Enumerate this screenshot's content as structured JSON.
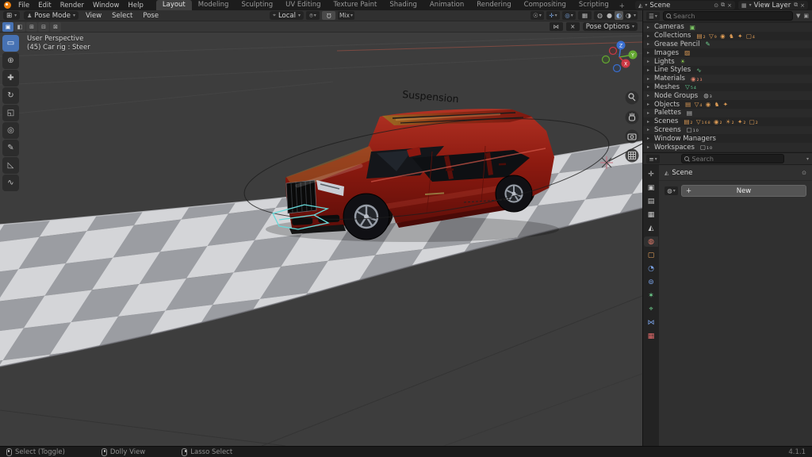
{
  "icons": {
    "chevron_down": "▾",
    "chevron_right": "▸",
    "editor_type_3d": "⊞",
    "editor_type_outliner": "☰",
    "editor_type_props": "≡",
    "pose_figure": "♟",
    "orientation": "⌖",
    "pivot": "⌾",
    "magnet": "Ω",
    "mirror_x": "⋈",
    "snap_x": "×",
    "visibility_eye": "☉",
    "gizmo_toggle": "✛",
    "overlays_toggle": "◎",
    "xray_toggle": "▦",
    "pin": "⊙",
    "copy_datablock": "⧉",
    "close_x": "×",
    "funnel": "▼",
    "collection_box": "▣",
    "scene_crumb": "◭",
    "world_globe": "◍",
    "plus": "+"
  },
  "topbar": {
    "menus": [
      {
        "label": "File"
      },
      {
        "label": "Edit"
      },
      {
        "label": "Render"
      },
      {
        "label": "Window"
      },
      {
        "label": "Help"
      }
    ],
    "tabs": [
      {
        "label": "Layout",
        "active": true
      },
      {
        "label": "Modeling"
      },
      {
        "label": "Sculpting"
      },
      {
        "label": "UV Editing"
      },
      {
        "label": "Texture Paint"
      },
      {
        "label": "Shading"
      },
      {
        "label": "Animation"
      },
      {
        "label": "Rendering"
      },
      {
        "label": "Compositing"
      },
      {
        "label": "Scripting"
      }
    ],
    "add_tab": "+",
    "scene_selector": {
      "label": "Scene"
    },
    "view_layer_selector": {
      "label": "View Layer"
    }
  },
  "viewport_header": {
    "mode_label": "Pose Mode",
    "menus": [
      {
        "label": "View"
      },
      {
        "label": "Select"
      },
      {
        "label": "Pose"
      }
    ],
    "orientation_label": "Local",
    "snap_label": "Mix",
    "pose_options_label": "Pose Options",
    "select_modes": [
      {
        "glyph": "▣",
        "active": true
      },
      {
        "glyph": "◧"
      },
      {
        "glyph": "⊞"
      },
      {
        "glyph": "⊟"
      },
      {
        "glyph": "⊠"
      }
    ],
    "shading_modes": [
      {
        "name": "wireframe",
        "glyph": "◍"
      },
      {
        "name": "solid",
        "glyph": "●"
      },
      {
        "name": "material-preview",
        "glyph": "◐",
        "active": true
      },
      {
        "name": "rendered",
        "glyph": "◑"
      }
    ]
  },
  "toolbar": {
    "tools": [
      {
        "name": "select-box",
        "glyph": "▭",
        "active": true
      },
      {
        "name": "cursor",
        "glyph": "⊕"
      },
      {
        "name": "move",
        "glyph": "✚"
      },
      {
        "name": "rotate",
        "glyph": "↻"
      },
      {
        "name": "scale",
        "glyph": "◱"
      },
      {
        "name": "transform",
        "glyph": "◎"
      },
      {
        "name": "annotate",
        "glyph": "✎"
      },
      {
        "name": "measure",
        "glyph": "◺"
      },
      {
        "name": "pose-breakdowner",
        "glyph": "∿"
      }
    ]
  },
  "viewport": {
    "perspective_label": "User Perspective",
    "context_label": "(45) Car rig : Steer",
    "scene_text": "Suspension",
    "gizmo": {
      "x": "X",
      "y": "Y",
      "z": "Z"
    }
  },
  "outliner": {
    "search_placeholder": "Search",
    "items": [
      {
        "label": "Cameras",
        "badges": "▣",
        "badge_color": "#7ac461"
      },
      {
        "label": "Collections",
        "badges": "▤₂ ▽₉ ◉ ♞ ✦ ▢₄",
        "badge_color": "#dc9b55"
      },
      {
        "label": "Grease Pencil",
        "badges": "✎",
        "badge_color": "#6fcf8f"
      },
      {
        "label": "Images",
        "badges": "▨",
        "badge_color": "#dc9b55"
      },
      {
        "label": "Lights",
        "badges": "☀",
        "badge_color": "#8fd14f"
      },
      {
        "label": "Line Styles",
        "badges": "∿",
        "badge_color": "#6fcf8f"
      },
      {
        "label": "Materials",
        "badges": "◉₂₃",
        "badge_color": "#e0826a"
      },
      {
        "label": "Meshes",
        "badges": "▽₅₄",
        "badge_color": "#5fc98f"
      },
      {
        "label": "Node Groups",
        "badges": "◍₃",
        "badge_color": "#b8b8b8"
      },
      {
        "label": "Objects",
        "badges": "▤ ▽₄ ◉ ♞ ✦",
        "badge_color": "#dc9b55"
      },
      {
        "label": "Palettes",
        "badges": "▤",
        "badge_color": "#c0c0c0"
      },
      {
        "label": "Scenes",
        "badges": "▤₂ ▽₁₆₈ ◉₂ ☀₂ ✦₂ ▢₂",
        "badge_color": "#dc9b55"
      },
      {
        "label": "Screens",
        "badges": "▢₁₀",
        "badge_color": "#c0c0c0"
      },
      {
        "label": "Window Managers",
        "badges": "",
        "badge_color": "#c0c0c0"
      },
      {
        "label": "Workspaces",
        "badges": "▢₁₀",
        "badge_color": "#c0c0c0"
      }
    ]
  },
  "properties": {
    "search_placeholder": "Search",
    "breadcrumb": "Scene",
    "world_new_button": "New",
    "tabs": [
      {
        "name": "tool",
        "glyph": "✛",
        "color": "#c6c6c6"
      },
      {
        "name": "render",
        "glyph": "▣",
        "color": "#c6c6c6"
      },
      {
        "name": "output",
        "glyph": "▤",
        "color": "#c6c6c6"
      },
      {
        "name": "view-layer",
        "glyph": "▦",
        "color": "#c6c6c6"
      },
      {
        "name": "scene",
        "glyph": "◭",
        "color": "#c6c6c6"
      },
      {
        "name": "world",
        "glyph": "◍",
        "color": "#e0796a",
        "active": true
      },
      {
        "name": "object",
        "glyph": "▢",
        "color": "#e8a25a"
      },
      {
        "name": "physics",
        "glyph": "◔",
        "color": "#7aa3e8"
      },
      {
        "name": "constraints",
        "glyph": "⊚",
        "color": "#7aa3e8"
      },
      {
        "name": "object-data",
        "glyph": "✶",
        "color": "#6fd08f"
      },
      {
        "name": "bone",
        "glyph": "⌖",
        "color": "#6fd08f"
      },
      {
        "name": "bone-constraints",
        "glyph": "⋈",
        "color": "#7aa3e8"
      },
      {
        "name": "texture",
        "glyph": "▦",
        "color": "#e06a6a"
      }
    ]
  },
  "statusbar": {
    "hints": [
      {
        "label": "Select (Toggle)",
        "button": "left"
      },
      {
        "label": "Dolly View",
        "button": "middle"
      },
      {
        "label": "Lasso Select",
        "button": "right"
      }
    ],
    "version": "4.1.1"
  },
  "colors": {
    "accent": "#4772b3",
    "checker_light": "#d4d5d8",
    "checker_dark": "#9b9da2",
    "car_red": "#8c1a10",
    "bone_select_cyan": "#67dada"
  }
}
